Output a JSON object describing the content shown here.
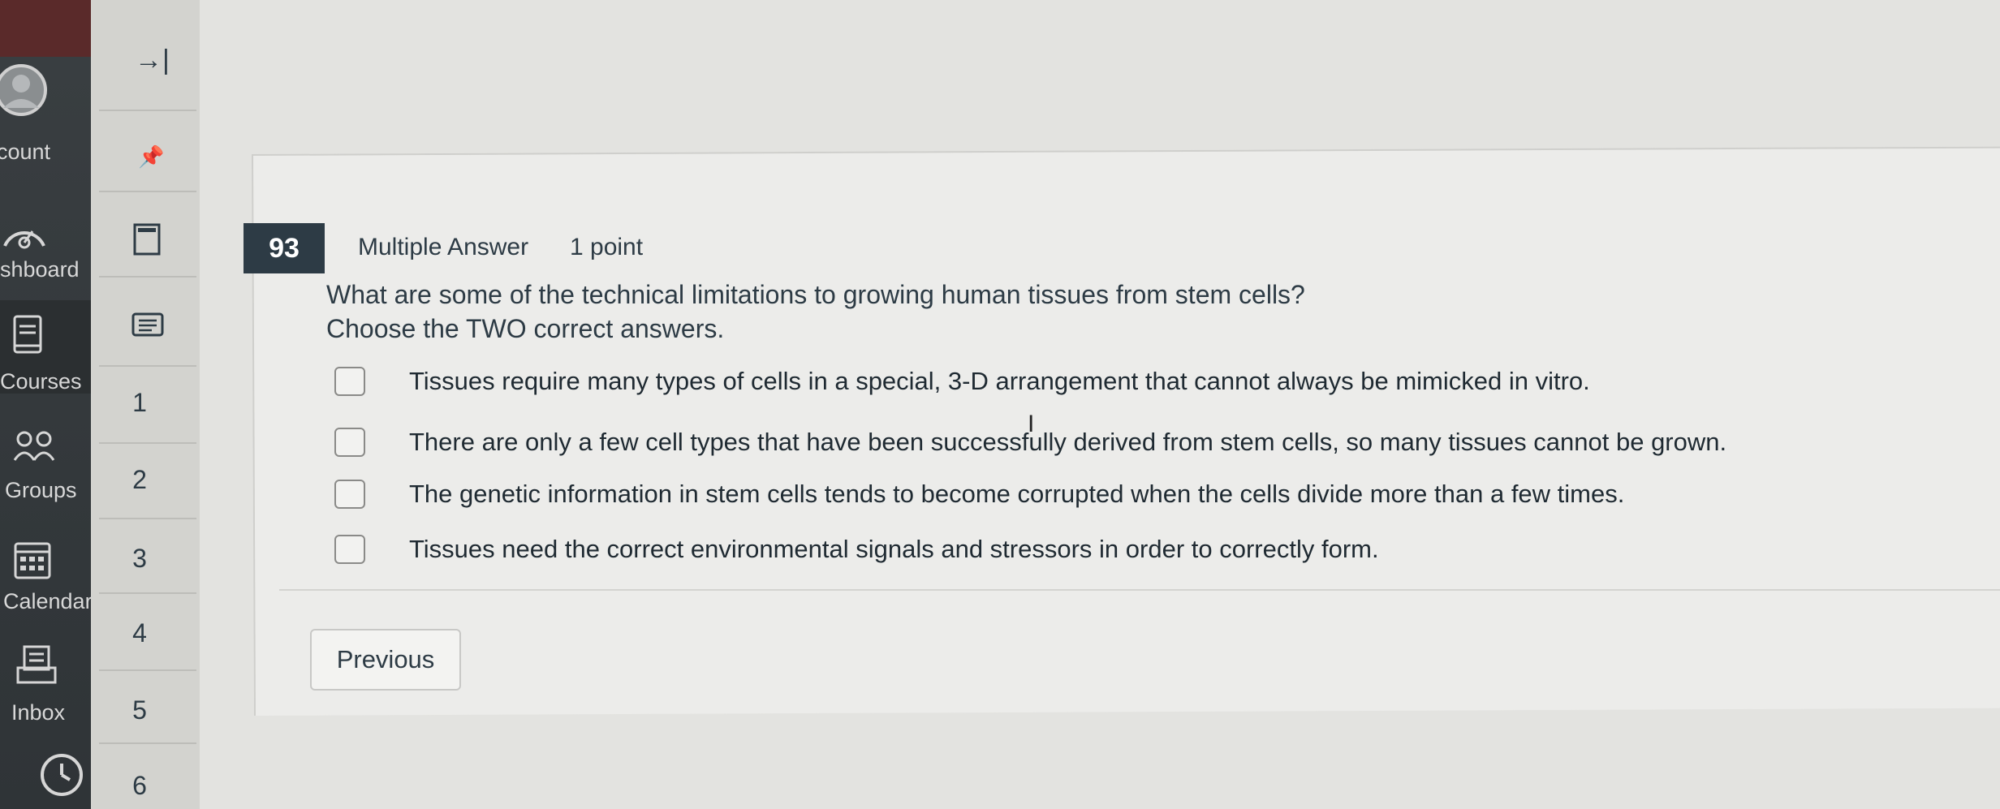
{
  "global_nav": {
    "items": [
      {
        "label": "count",
        "icon": "account-icon"
      },
      {
        "label": "shboard",
        "icon": "dashboard-icon"
      },
      {
        "label": "Courses",
        "icon": "courses-icon"
      },
      {
        "label": "Groups",
        "icon": "groups-icon"
      },
      {
        "label": "Calendar",
        "icon": "calendar-icon"
      },
      {
        "label": "Inbox",
        "icon": "inbox-icon"
      }
    ]
  },
  "course_nav": {
    "collapse_icon": "→|",
    "pin_icon": "📌",
    "numbers": [
      "1",
      "2",
      "3",
      "4",
      "5",
      "6"
    ]
  },
  "question": {
    "number": "93",
    "type": "Multiple Answer",
    "points": "1 point",
    "prompt_line1": "What are some of the technical limitations to growing human tissues from stem cells?",
    "prompt_line2": "Choose the TWO correct answers.",
    "answers": [
      "Tissues require many types of cells in a special, 3-D arrangement that cannot always be mimicked in vitro.",
      "There are only a few cell types that have been successfully derived from stem cells, so many tissues cannot be grown.",
      "The genetic information in stem cells tends to become corrupted when the cells divide more than a few times.",
      "Tissues need the correct environmental signals and stressors in order to correctly form."
    ]
  },
  "navigation": {
    "previous_label": "Previous"
  },
  "colors": {
    "global_nav_bg": "#34393c",
    "question_number_bg": "#2d3b45",
    "text": "#2d3b45"
  }
}
